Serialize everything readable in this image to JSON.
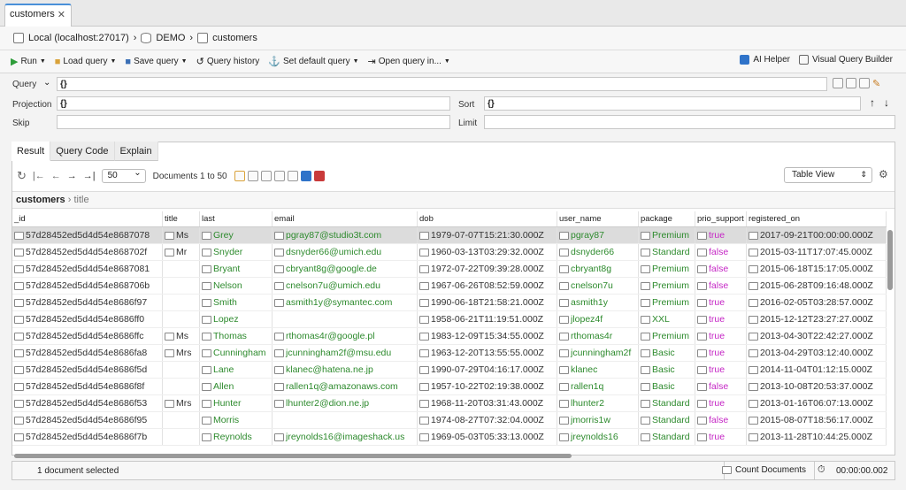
{
  "tab": {
    "title": "customers"
  },
  "breadcrumb": {
    "connection": "Local (localhost:27017)",
    "database": "DEMO",
    "collection": "customers"
  },
  "toolbar": {
    "run": "Run",
    "load_query": "Load query",
    "save_query": "Save query",
    "query_history": "Query history",
    "set_default_query": "Set default query",
    "open_query_in": "Open query in...",
    "ai_helper": "AI Helper",
    "visual_query_builder": "Visual Query Builder"
  },
  "query": {
    "query_label": "Query",
    "query_value": "{}",
    "projection_label": "Projection",
    "projection_value": "{}",
    "sort_label": "Sort",
    "sort_value": "{}",
    "skip_label": "Skip",
    "skip_value": "",
    "limit_label": "Limit",
    "limit_value": ""
  },
  "result_tabs": [
    "Result",
    "Query Code",
    "Explain"
  ],
  "navigation": {
    "page_size": "50",
    "documents_range": "Documents 1 to 50",
    "view_mode": "Table View"
  },
  "path": {
    "collection": "customers",
    "field": "title"
  },
  "columns": [
    "_id",
    "title",
    "last",
    "email",
    "dob",
    "user_name",
    "package",
    "prio_support",
    "registered_on"
  ],
  "rows": [
    [
      "57d28452ed5d4d54e8687078",
      "Ms",
      "Grey",
      "pgray87@studio3t.com",
      "1979-07-07T15:21:30.000Z",
      "pgray87",
      "Premium",
      "true",
      "2017-09-21T00:00:00.000Z"
    ],
    [
      "57d28452ed5d4d54e868702f",
      "Mr",
      "Snyder",
      "dsnyder66@umich.edu",
      "1960-03-13T03:29:32.000Z",
      "dsnyder66",
      "Standard",
      "false",
      "2015-03-11T17:07:45.000Z"
    ],
    [
      "57d28452ed5d4d54e8687081",
      "",
      "Bryant",
      "cbryant8g@google.de",
      "1972-07-22T09:39:28.000Z",
      "cbryant8g",
      "Premium",
      "false",
      "2015-06-18T15:17:05.000Z"
    ],
    [
      "57d28452ed5d4d54e868706b",
      "",
      "Nelson",
      "cnelson7u@umich.edu",
      "1967-06-26T08:52:59.000Z",
      "cnelson7u",
      "Premium",
      "false",
      "2015-06-28T09:16:48.000Z"
    ],
    [
      "57d28452ed5d4d54e8686f97",
      "",
      "Smith",
      "asmith1y@symantec.com",
      "1990-06-18T21:58:21.000Z",
      "asmith1y",
      "Premium",
      "true",
      "2016-02-05T03:28:57.000Z"
    ],
    [
      "57d28452ed5d4d54e8686ff0",
      "",
      "Lopez",
      "",
      "1958-06-21T11:19:51.000Z",
      "jlopez4f",
      "XXL",
      "true",
      "2015-12-12T23:27:27.000Z"
    ],
    [
      "57d28452ed5d4d54e8686ffc",
      "Ms",
      "Thomas",
      "rthomas4r@google.pl",
      "1983-12-09T15:34:55.000Z",
      "rthomas4r",
      "Premium",
      "true",
      "2013-04-30T22:42:27.000Z"
    ],
    [
      "57d28452ed5d4d54e8686fa8",
      "Mrs",
      "Cunningham",
      "jcunningham2f@msu.edu",
      "1963-12-20T13:55:55.000Z",
      "jcunningham2f",
      "Basic",
      "true",
      "2013-04-29T03:12:40.000Z"
    ],
    [
      "57d28452ed5d4d54e8686f5d",
      "",
      "Lane",
      "klanec@hatena.ne.jp",
      "1990-07-29T04:16:17.000Z",
      "klanec",
      "Basic",
      "true",
      "2014-11-04T01:12:15.000Z"
    ],
    [
      "57d28452ed5d4d54e8686f8f",
      "",
      "Allen",
      "rallen1q@amazonaws.com",
      "1957-10-22T02:19:38.000Z",
      "rallen1q",
      "Basic",
      "false",
      "2013-10-08T20:53:37.000Z"
    ],
    [
      "57d28452ed5d4d54e8686f53",
      "Mrs",
      "Hunter",
      "lhunter2@dion.ne.jp",
      "1968-11-20T03:31:43.000Z",
      "lhunter2",
      "Standard",
      "true",
      "2013-01-16T06:07:13.000Z"
    ],
    [
      "57d28452ed5d4d54e8686f95",
      "",
      "Morris",
      "",
      "1974-08-27T07:32:04.000Z",
      "jmorris1w",
      "Standard",
      "false",
      "2015-08-07T18:56:17.000Z"
    ],
    [
      "57d28452ed5d4d54e8686f7b",
      "",
      "Reynolds",
      "jreynolds16@imageshack.us",
      "1969-05-03T05:33:13.000Z",
      "jreynolds16",
      "Standard",
      "true",
      "2013-11-28T10:44:25.000Z"
    ]
  ],
  "status": {
    "selection": "1 document selected",
    "count_documents": "Count Documents",
    "elapsed": "00:00:00.002"
  }
}
